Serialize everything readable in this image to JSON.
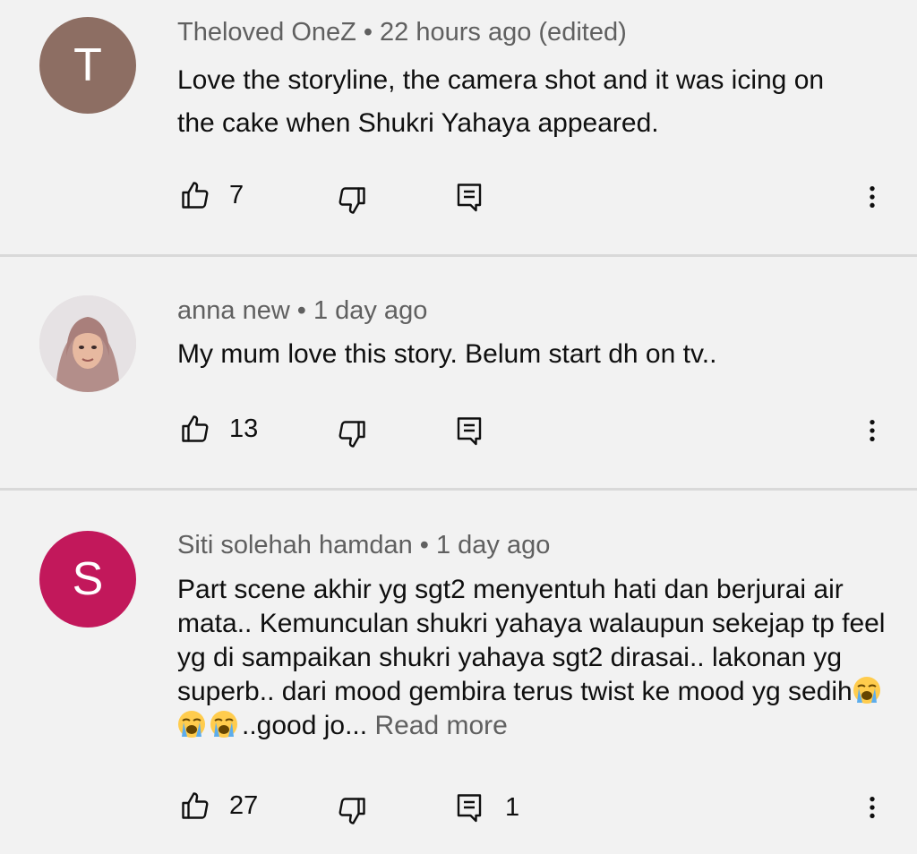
{
  "comments": [
    {
      "avatar_letter": "T",
      "avatar_color": "#8d6e63",
      "author": "Theloved OneZ",
      "separator": "•",
      "time": "22 hours ago (edited)",
      "text": "Love the storyline, the camera shot and it was icing on the cake when Shukri Yahaya appeared.",
      "likes": "7",
      "replies": ""
    },
    {
      "avatar_letter": "",
      "avatar_color": "#d9c8c8",
      "author": "anna new",
      "separator": "•",
      "time": "1 day ago",
      "text": "My mum love this story. Belum start dh on tv..",
      "likes": "13",
      "replies": ""
    },
    {
      "avatar_letter": "S",
      "avatar_color": "#c2185b",
      "author": "Siti solehah hamdan",
      "separator": "•",
      "time": "1 day ago",
      "text_main": "Part scene akhir yg sgt2 menyentuh hati dan berjurai air mata.. Kemunculan shukri yahaya walaupun sekejap tp feel yg di sampaikan shukri yahaya sgt2 dirasai.. lakonan yg superb.. dari mood gembira terus twist ke mood yg sedih",
      "emoji": [
        "loudly-crying-face",
        "loudly-crying-face",
        "loudly-crying-face"
      ],
      "text_tail": "..good jo...",
      "read_more": "Read more",
      "likes": "27",
      "replies": "1"
    }
  ]
}
